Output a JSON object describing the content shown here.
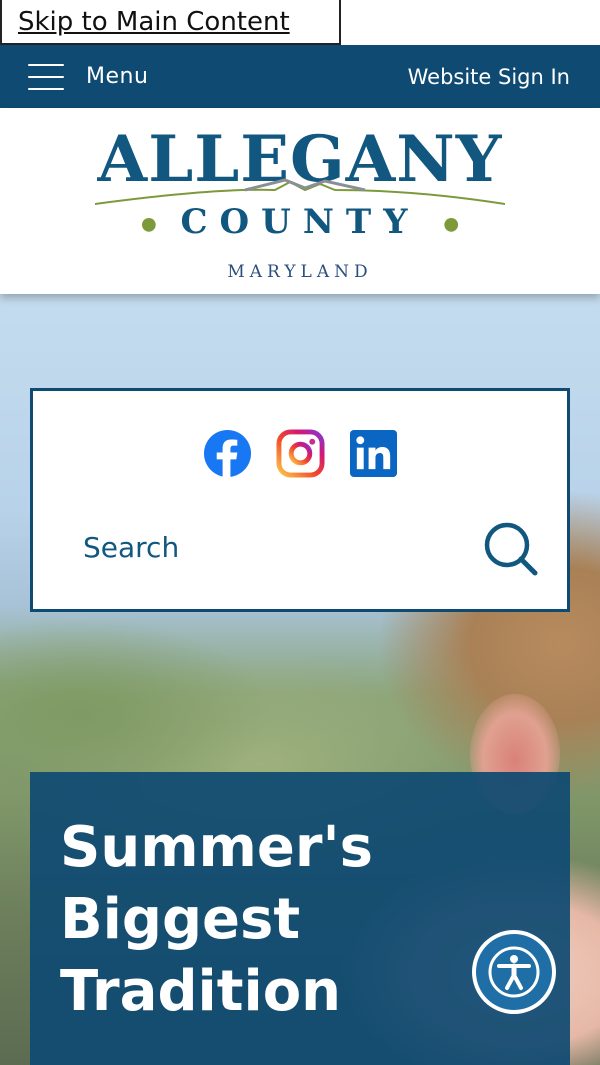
{
  "skip_link": {
    "label": "Skip to Main Content"
  },
  "topbar": {
    "menu_label": "Menu",
    "signin_label": "Website Sign In"
  },
  "logo": {
    "line1": "ALLEGANY",
    "line2": "COUNTY",
    "line3": "MARYLAND"
  },
  "social": [
    {
      "name": "facebook-icon",
      "color": "#1877f2"
    },
    {
      "name": "instagram-icon",
      "color": "#e1306c"
    },
    {
      "name": "linkedin-icon",
      "color": "#0a66c2"
    }
  ],
  "search": {
    "label": "Search"
  },
  "feature": {
    "title": "Summer's Biggest Tradition"
  },
  "colors": {
    "brand": "#0f4a72",
    "text_blue": "#11577f",
    "accent_green": "#7c9a3a"
  }
}
